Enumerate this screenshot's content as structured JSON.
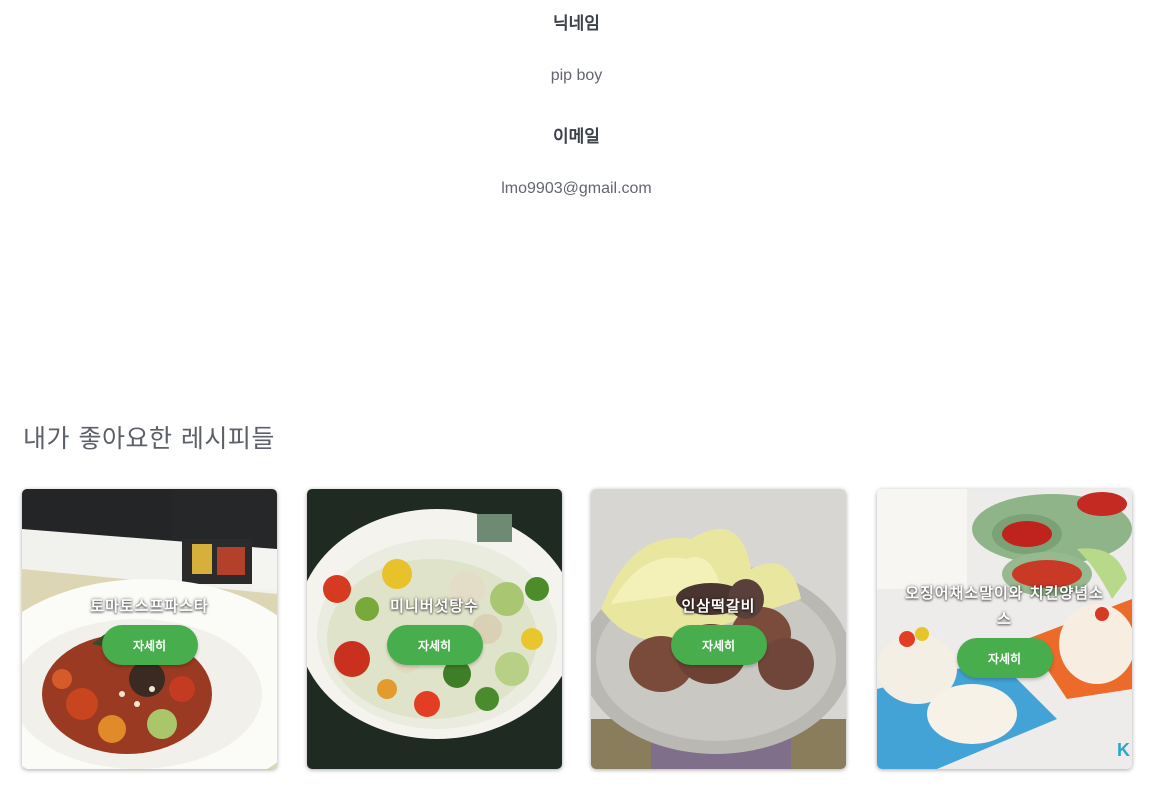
{
  "profile": {
    "nickname_label": "닉네임",
    "nickname_value": "pip boy",
    "email_label": "이메일",
    "email_value": "lmo9903@gmail.com"
  },
  "liked_section": {
    "title": "내가 좋아요한 레시피들"
  },
  "recipes": [
    {
      "title": "토마토스프파스타",
      "button_label": "자세히",
      "photo_icon": "pasta-photo"
    },
    {
      "title": "미니버섯탕수",
      "button_label": "자세히",
      "photo_icon": "stirfry-photo"
    },
    {
      "title": "인삼떡갈비",
      "button_label": "자세히",
      "photo_icon": "tteokgalbi-photo"
    },
    {
      "title": "오징어채소말이와 치킨양념소스",
      "button_label": "자세히",
      "photo_icon": "squid-roll-photo",
      "watermark": "K"
    }
  ],
  "colors": {
    "button_bg": "#47ad4d",
    "text_primary": "#3d4148",
    "text_secondary": "#62666e"
  }
}
